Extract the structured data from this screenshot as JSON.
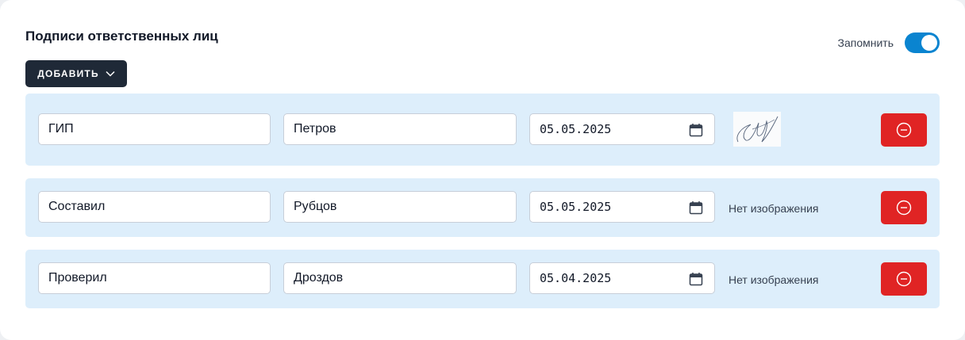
{
  "title": "Подписи ответственных лиц",
  "remember": {
    "label": "Запомнить",
    "enabled": true
  },
  "add_button": {
    "label": "ДОБАВИТЬ"
  },
  "rows": [
    {
      "role": "ГИП",
      "name": "Петров",
      "date": "05.05.2025",
      "signature": "image"
    },
    {
      "role": "Составил",
      "name": "Рубцов",
      "date": "05.05.2025",
      "signature": "Нет изображения"
    },
    {
      "role": "Проверил",
      "name": "Дроздов",
      "date": "05.04.2025",
      "signature": "Нет изображения"
    }
  ],
  "colors": {
    "accent": "#0a84d0",
    "dark_button": "#1f2937",
    "row_background": "#ddeefb",
    "danger": "#e02424"
  },
  "icons": {
    "add_chevron": "chevron-down-icon",
    "date": "calendar-icon",
    "remove": "minus-circle-icon"
  }
}
